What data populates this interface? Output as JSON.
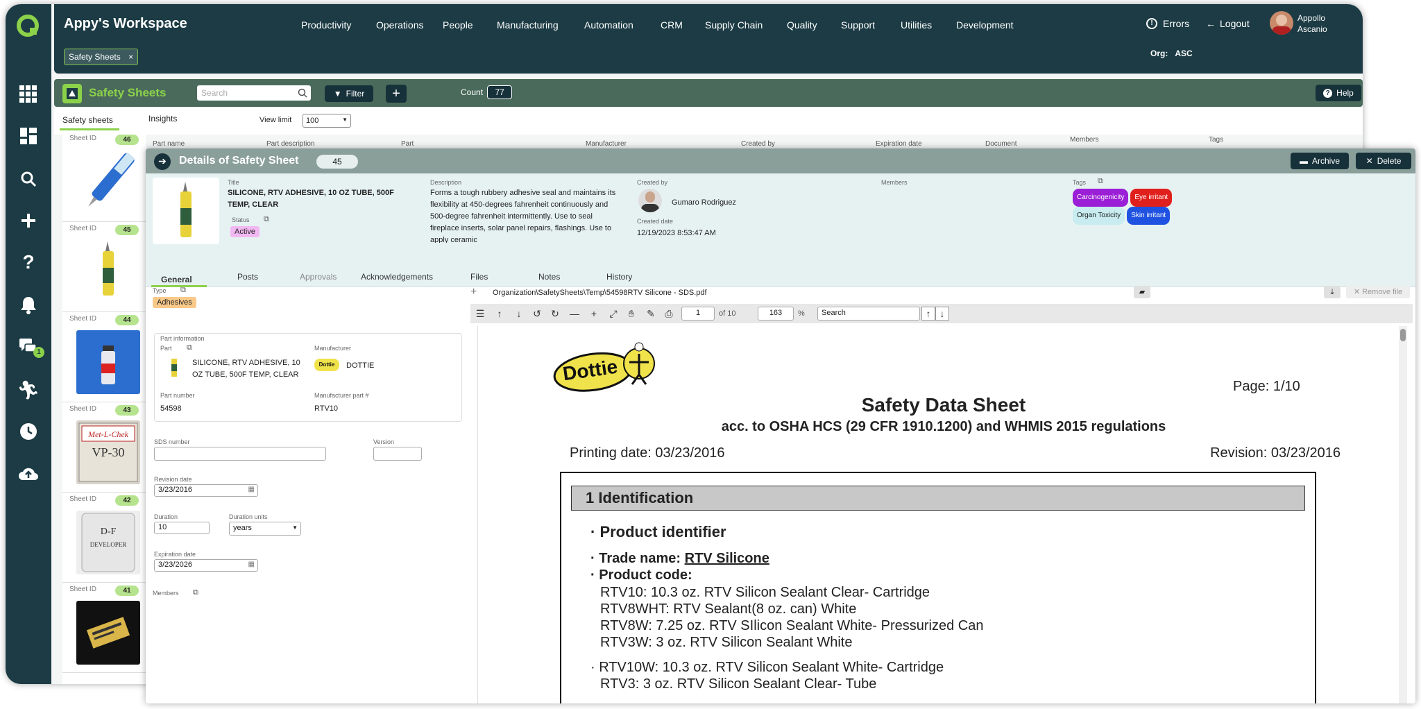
{
  "app": {
    "title": "Appy's Workspace",
    "menu": [
      "Productivity",
      "Operations",
      "People",
      "Manufacturing",
      "Automation",
      "CRM",
      "Supply Chain",
      "Quality",
      "Support",
      "Utilities",
      "Development"
    ],
    "errors_label": "Errors",
    "logout_label": "Logout",
    "user_first": "Appollo",
    "user_last": "Ascanio",
    "org_label": "Org:",
    "org_value": "ASC",
    "chip_label": "Safety Sheets",
    "notification_badge": "1"
  },
  "module": {
    "title": "Safety Sheets",
    "search_placeholder": "Search",
    "filter_label": "Filter",
    "count_label": "Count",
    "count_value": "77",
    "help_label": "Help",
    "tabs": [
      "Safety sheets",
      "Insights"
    ],
    "view_limit_label": "View limit",
    "view_limit_value": "100",
    "columns": [
      "Part name",
      "Part description",
      "Part",
      "Manufacturer",
      "Created by",
      "Expiration date",
      "Document",
      "Members",
      "Tags"
    ]
  },
  "cards": [
    {
      "label": "Sheet ID",
      "id": "46"
    },
    {
      "label": "Sheet ID",
      "id": "45"
    },
    {
      "label": "Sheet ID",
      "id": "44"
    },
    {
      "label": "Sheet ID",
      "id": "43"
    },
    {
      "label": "Sheet ID",
      "id": "42"
    },
    {
      "label": "Sheet ID",
      "id": "41"
    }
  ],
  "detail": {
    "header_title": "Details of Safety Sheet",
    "header_id": "45",
    "archive_label": "Archive",
    "delete_label": "Delete",
    "title_label": "Title",
    "title_value": "SILICONE, RTV ADHESIVE, 10 OZ TUBE, 500F TEMP, CLEAR",
    "status_label": "Status",
    "status_value": "Active",
    "description_label": "Description",
    "description_value": "Forms a tough rubbery adhesive seal and maintains its flexibility at 450-degrees fahrenheit continuously and 500-degree fahrenheit intermittently. Use to seal fireplace inserts, solar panel repairs, flashings. Use to apply ceramic",
    "created_by_label": "Created by",
    "created_by_value": "Gumaro Rodriguez",
    "created_date_label": "Created date",
    "created_date_value": "12/19/2023 8:53:47 AM",
    "members_label": "Members",
    "tags_label": "Tags",
    "tags": [
      {
        "label": "Carcinogenicity",
        "bg": "#9b1fd6"
      },
      {
        "label": "Eye irritant",
        "bg": "#e0201c"
      },
      {
        "label": "Organ Toxicity",
        "bg": "#c8ecef"
      },
      {
        "label": "Skin irritant",
        "bg": "#1f52e0"
      }
    ],
    "tabs": [
      "General",
      "Posts",
      "Approvals",
      "Acknowledgements",
      "Files",
      "Notes",
      "History"
    ],
    "type_label": "Type",
    "type_value": "Adhesives",
    "part_info_label": "Part information",
    "part_label": "Part",
    "part_value": "SILICONE, RTV ADHESIVE, 10 OZ TUBE, 500F TEMP, CLEAR",
    "manufacturer_label": "Manufacturer",
    "manufacturer_value": "DOTTIE",
    "part_number_label": "Part number",
    "part_number_value": "54598",
    "mfr_part_label": "Manufacturer part #",
    "mfr_part_value": "RTV10",
    "sds_label": "SDS number",
    "version_label": "Version",
    "revision_label": "Revision date",
    "revision_value": "3/23/2016",
    "duration_label": "Duration",
    "duration_value": "10",
    "duration_units_label": "Duration units",
    "duration_units_value": "years",
    "expiration_label": "Expiration date",
    "expiration_value": "3/23/2026",
    "members2_label": "Members"
  },
  "pdf": {
    "path": "Organization\\SafetySheets\\Temp\\54598RTV Silicone - SDS.pdf",
    "remove_label": "Remove file",
    "page_value": "1",
    "page_of": "of 10",
    "zoom_value": "163",
    "zoom_unit": "%",
    "search_placeholder": "Search",
    "logo_text": "Dottie",
    "page_label": "Page: 1/10",
    "doc_title": "Safety Data Sheet",
    "doc_subtitle": "acc. to OSHA HCS (29 CFR 1910.1200) and WHMIS 2015 regulations",
    "printing_date": "Printing date: 03/23/2016",
    "revision": "Revision: 03/23/2016",
    "section_title": "1 Identification",
    "product_identifier": "· Product identifier",
    "trade_name_prefix": "· Trade name: ",
    "trade_name": "RTV Silicone",
    "product_code": "· Product code:",
    "codes": [
      "RTV10: 10.3 oz. RTV Silicon Sealant Clear- Cartridge",
      "RTV8WHT: RTV Sealant(8 oz. can) White",
      "RTV8W: 7.25 oz. RTV SIlicon Sealant White- Pressurized Can",
      "RTV3W: 3 oz. RTV Silicon Sealant White"
    ],
    "codes2": [
      "· RTV10W: 10.3 oz. RTV Silicon Sealant White- Cartridge",
      "RTV3: 3 oz. RTV Silicon Sealant Clear- Tube"
    ]
  }
}
